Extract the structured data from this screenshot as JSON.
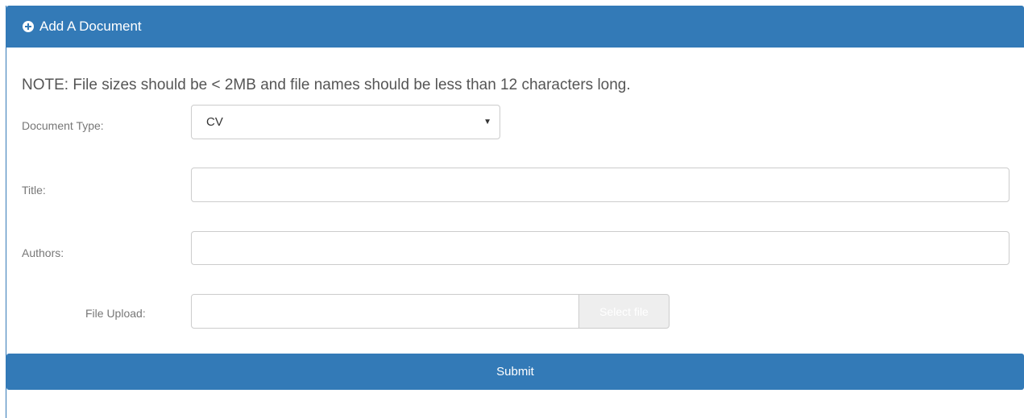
{
  "header": {
    "title": "Add A Document",
    "icon": "plus-circle-icon"
  },
  "note": "NOTE: File sizes should be < 2MB and file names should be less than 12 characters long.",
  "form": {
    "document_type": {
      "label": "Document Type:",
      "value": "CV",
      "caret": "▼"
    },
    "title": {
      "label": "Title:",
      "value": ""
    },
    "authors": {
      "label": "Authors:",
      "value": ""
    },
    "file_upload": {
      "label": "File Upload:",
      "value": "",
      "button_label": "Select file"
    }
  },
  "submit_label": "Submit",
  "colors": {
    "primary": "#337ab7",
    "border": "#cccccc",
    "muted_button": "#eeeeee"
  }
}
